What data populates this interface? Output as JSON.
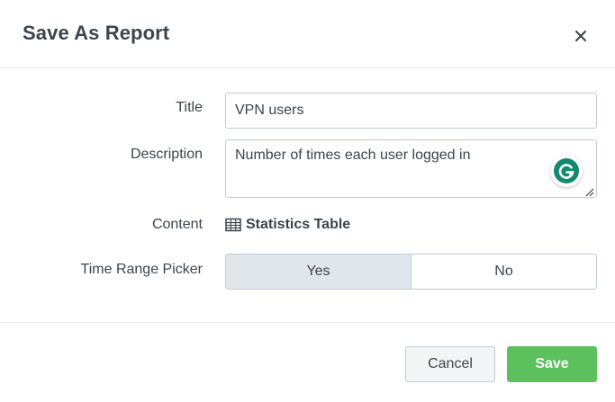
{
  "dialog": {
    "title": "Save As Report"
  },
  "form": {
    "title_label": "Title",
    "title_value": "VPN users",
    "description_label": "Description",
    "description_value": "Number of times each user logged in",
    "content_label": "Content",
    "content_value": "Statistics Table",
    "content_icon": "table-icon",
    "time_range_label": "Time Range Picker",
    "time_range_options": [
      "Yes",
      "No"
    ],
    "time_range_selected": "Yes"
  },
  "footer": {
    "cancel_label": "Cancel",
    "save_label": "Save"
  },
  "colors": {
    "save_green": "#5cc05c",
    "selected_toggle": "#e1e6eb",
    "grammarly": "#128a6e"
  }
}
